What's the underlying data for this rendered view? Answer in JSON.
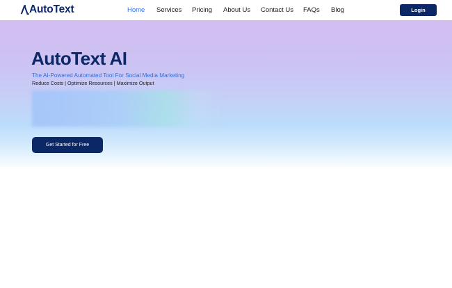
{
  "brand": {
    "logo_text": "AutoText",
    "accent_color": "#0b2766",
    "link_color": "#2f6fe0"
  },
  "nav": {
    "items": [
      {
        "label": "Home",
        "active": true
      },
      {
        "label": "Services",
        "active": false
      },
      {
        "label": "Pricing",
        "active": false
      },
      {
        "label": "About Us",
        "active": false
      },
      {
        "label": "Contact Us",
        "active": false
      },
      {
        "label": "FAQs",
        "active": false
      },
      {
        "label": "Blog",
        "active": false
      }
    ],
    "login_label": "Login"
  },
  "hero": {
    "title": "AutoText AI",
    "subtitle": "The AI-Powered Automated Tool For Social Media Marketing",
    "tagline": "Reduce Costs | Optimize Resources | Maximize Output",
    "cta_label": "Get Started for Free"
  }
}
